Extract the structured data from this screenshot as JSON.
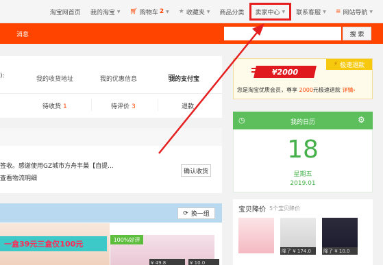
{
  "topnav": {
    "home": "淘宝网首页",
    "my_taobao": "我的淘宝",
    "cart": "购物车",
    "cart_count": "2",
    "favorites": "收藏夹",
    "categories": "商品分类",
    "seller_center": "卖家中心",
    "customer_service": "联系客服",
    "site_nav": "网站导航"
  },
  "header": {
    "messages": "消息",
    "search_placeholder": "",
    "search_button": "搜 索"
  },
  "account": {
    "left_paren": "):",
    "address": "我的收货地址",
    "coupons": "我的优惠信息",
    "alipay": "我的支付宝"
  },
  "order_status": {
    "to_receive_label": "待收货",
    "to_receive_count": "1",
    "to_review_label": "待评价",
    "to_review_count": "3",
    "refund_label": "退款"
  },
  "order": {
    "description": "签收。感谢使用GZ城市方舟丰巢【自提...",
    "link": "查看物流明细",
    "confirm_button": "确认收货"
  },
  "recommend": {
    "swap_button": "换一组",
    "promo_banner": "一盒39元三盒仅100元",
    "praise_badge": "100%好评",
    "price_a": "¥ 49.8",
    "price_b": "¥ 10.0"
  },
  "refund": {
    "amount": "¥2000",
    "badge": "极速退款",
    "desc_prefix": "您是淘宝优质会员，尊享",
    "desc_amount": "2000",
    "desc_suffix": "元极速退款",
    "details": "详情›"
  },
  "calendar": {
    "title": "我的日历",
    "day": "18",
    "weekday": "星期五",
    "year_month": "2019.01"
  },
  "price_drop": {
    "title": "宝贝降价",
    "subtitle": "5个宝贝降价",
    "items": [
      {
        "label": "降了 ¥ 174.0"
      },
      {
        "label": "降了 ¥ 10.0"
      }
    ]
  },
  "colors": {
    "brand_orange": "#ff4400",
    "highlight_red": "#e51f1f",
    "calendar_green": "#5cbf5c"
  },
  "icons": [
    "cart-icon",
    "star-icon",
    "menu-icon",
    "chevron-down-icon",
    "clock-icon",
    "gear-icon",
    "refresh-icon",
    "bolt-icon",
    "alipay-icon"
  ]
}
